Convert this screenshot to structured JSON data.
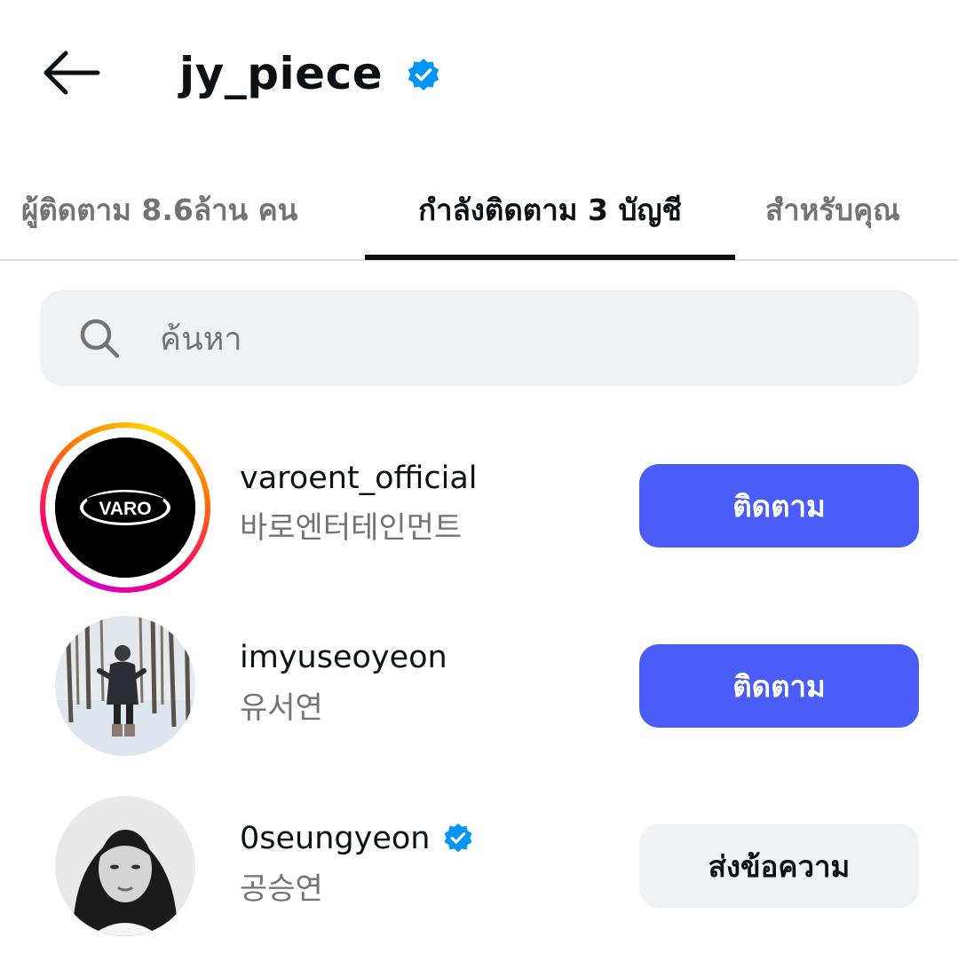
{
  "header": {
    "back_icon": "arrow-left-icon",
    "title": "jy_piece",
    "verified_icon": "verified-badge-icon",
    "verified_color": "#0095f6"
  },
  "tabs": [
    {
      "label": "ผู้ติดตาม 8.6ล้าน คน",
      "active": false
    },
    {
      "label": "กำลังติดตาม 3 บัญชี",
      "active": true
    },
    {
      "label": "สำหรับคุณ",
      "active": false
    }
  ],
  "search": {
    "icon": "search-icon",
    "placeholder": "ค้นหา"
  },
  "accounts": [
    {
      "username": "varoent_official",
      "full_name": "바로엔터테인먼트",
      "avatar_logo_text": "VARO",
      "has_story": true,
      "verified": false,
      "button_label": "ติดตาม",
      "button_style": "primary"
    },
    {
      "username": "imyuseoyeon",
      "full_name": "유서연",
      "has_story": false,
      "verified": false,
      "button_label": "ติดตาม",
      "button_style": "primary"
    },
    {
      "username": "0seungyeon",
      "full_name": "공승연",
      "has_story": false,
      "verified": true,
      "button_label": "ส่งข้อความ",
      "button_style": "secondary"
    }
  ],
  "colors": {
    "primary_button": "#4a5df9",
    "secondary_button": "#eff2f5",
    "secondary_text": "#737373",
    "text": "#0c1014"
  }
}
